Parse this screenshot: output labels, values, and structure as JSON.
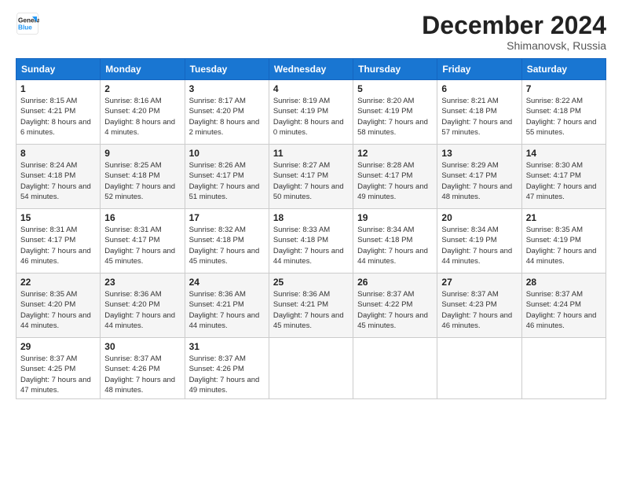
{
  "header": {
    "logo_line1": "General",
    "logo_line2": "Blue",
    "month": "December 2024",
    "location": "Shimanovsk, Russia"
  },
  "weekdays": [
    "Sunday",
    "Monday",
    "Tuesday",
    "Wednesday",
    "Thursday",
    "Friday",
    "Saturday"
  ],
  "weeks": [
    [
      {
        "day": "1",
        "sunrise": "8:15 AM",
        "sunset": "4:21 PM",
        "daylight": "8 hours and 6 minutes."
      },
      {
        "day": "2",
        "sunrise": "8:16 AM",
        "sunset": "4:20 PM",
        "daylight": "8 hours and 4 minutes."
      },
      {
        "day": "3",
        "sunrise": "8:17 AM",
        "sunset": "4:20 PM",
        "daylight": "8 hours and 2 minutes."
      },
      {
        "day": "4",
        "sunrise": "8:19 AM",
        "sunset": "4:19 PM",
        "daylight": "8 hours and 0 minutes."
      },
      {
        "day": "5",
        "sunrise": "8:20 AM",
        "sunset": "4:19 PM",
        "daylight": "7 hours and 58 minutes."
      },
      {
        "day": "6",
        "sunrise": "8:21 AM",
        "sunset": "4:18 PM",
        "daylight": "7 hours and 57 minutes."
      },
      {
        "day": "7",
        "sunrise": "8:22 AM",
        "sunset": "4:18 PM",
        "daylight": "7 hours and 55 minutes."
      }
    ],
    [
      {
        "day": "8",
        "sunrise": "8:24 AM",
        "sunset": "4:18 PM",
        "daylight": "7 hours and 54 minutes."
      },
      {
        "day": "9",
        "sunrise": "8:25 AM",
        "sunset": "4:18 PM",
        "daylight": "7 hours and 52 minutes."
      },
      {
        "day": "10",
        "sunrise": "8:26 AM",
        "sunset": "4:17 PM",
        "daylight": "7 hours and 51 minutes."
      },
      {
        "day": "11",
        "sunrise": "8:27 AM",
        "sunset": "4:17 PM",
        "daylight": "7 hours and 50 minutes."
      },
      {
        "day": "12",
        "sunrise": "8:28 AM",
        "sunset": "4:17 PM",
        "daylight": "7 hours and 49 minutes."
      },
      {
        "day": "13",
        "sunrise": "8:29 AM",
        "sunset": "4:17 PM",
        "daylight": "7 hours and 48 minutes."
      },
      {
        "day": "14",
        "sunrise": "8:30 AM",
        "sunset": "4:17 PM",
        "daylight": "7 hours and 47 minutes."
      }
    ],
    [
      {
        "day": "15",
        "sunrise": "8:31 AM",
        "sunset": "4:17 PM",
        "daylight": "7 hours and 46 minutes."
      },
      {
        "day": "16",
        "sunrise": "8:31 AM",
        "sunset": "4:17 PM",
        "daylight": "7 hours and 45 minutes."
      },
      {
        "day": "17",
        "sunrise": "8:32 AM",
        "sunset": "4:18 PM",
        "daylight": "7 hours and 45 minutes."
      },
      {
        "day": "18",
        "sunrise": "8:33 AM",
        "sunset": "4:18 PM",
        "daylight": "7 hours and 44 minutes."
      },
      {
        "day": "19",
        "sunrise": "8:34 AM",
        "sunset": "4:18 PM",
        "daylight": "7 hours and 44 minutes."
      },
      {
        "day": "20",
        "sunrise": "8:34 AM",
        "sunset": "4:19 PM",
        "daylight": "7 hours and 44 minutes."
      },
      {
        "day": "21",
        "sunrise": "8:35 AM",
        "sunset": "4:19 PM",
        "daylight": "7 hours and 44 minutes."
      }
    ],
    [
      {
        "day": "22",
        "sunrise": "8:35 AM",
        "sunset": "4:20 PM",
        "daylight": "7 hours and 44 minutes."
      },
      {
        "day": "23",
        "sunrise": "8:36 AM",
        "sunset": "4:20 PM",
        "daylight": "7 hours and 44 minutes."
      },
      {
        "day": "24",
        "sunrise": "8:36 AM",
        "sunset": "4:21 PM",
        "daylight": "7 hours and 44 minutes."
      },
      {
        "day": "25",
        "sunrise": "8:36 AM",
        "sunset": "4:21 PM",
        "daylight": "7 hours and 45 minutes."
      },
      {
        "day": "26",
        "sunrise": "8:37 AM",
        "sunset": "4:22 PM",
        "daylight": "7 hours and 45 minutes."
      },
      {
        "day": "27",
        "sunrise": "8:37 AM",
        "sunset": "4:23 PM",
        "daylight": "7 hours and 46 minutes."
      },
      {
        "day": "28",
        "sunrise": "8:37 AM",
        "sunset": "4:24 PM",
        "daylight": "7 hours and 46 minutes."
      }
    ],
    [
      {
        "day": "29",
        "sunrise": "8:37 AM",
        "sunset": "4:25 PM",
        "daylight": "7 hours and 47 minutes."
      },
      {
        "day": "30",
        "sunrise": "8:37 AM",
        "sunset": "4:26 PM",
        "daylight": "7 hours and 48 minutes."
      },
      {
        "day": "31",
        "sunrise": "8:37 AM",
        "sunset": "4:26 PM",
        "daylight": "7 hours and 49 minutes."
      },
      null,
      null,
      null,
      null
    ]
  ]
}
